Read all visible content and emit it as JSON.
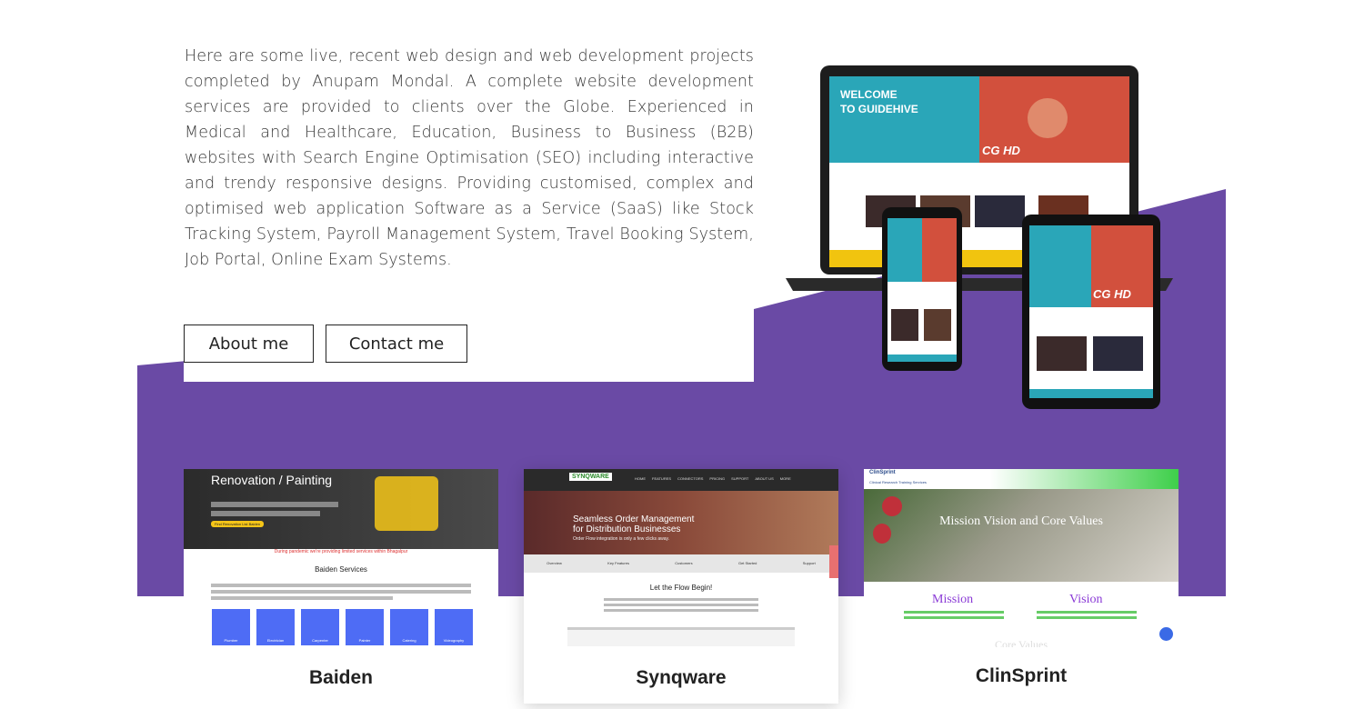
{
  "intro": {
    "text": "Here are some live, recent web design and web development projects completed by Anupam Mondal. A complete website development services are provided to clients over the Globe. Experienced in Medical and Healthcare, Education, Business to Business (B2B) websites with Search Engine Optimisation (SEO) including interactive and trendy responsive designs. Providing customised, complex and optimised web application Software as a Service (SaaS) like Stock Tracking System, Payroll Management System, Travel Booking System, Job Portal, Online Exam Systems."
  },
  "buttons": {
    "about": "About me",
    "contact": "Contact me"
  },
  "devices": {
    "welcome_line1": "WELCOME",
    "welcome_line2": "TO GUIDEHIVE",
    "hd_badge": "CG HD"
  },
  "projects": [
    {
      "title": "Baiden",
      "hero": "Renovation / Painting",
      "cta": "Find Renovation List Baiden",
      "notice": "During pandemic we're providing limited services within Bhagalpur",
      "heading": "Baiden Services",
      "services": [
        "Plumber",
        "Electrician",
        "Carpenter",
        "Painter",
        "Catering",
        "Videography"
      ]
    },
    {
      "title": "Synqware",
      "logo": "SYNQWARE",
      "nav": [
        "HOME",
        "FEATURES",
        "CONNECTORS",
        "PRICING",
        "SUPPORT",
        "ABOUT US",
        "MORE"
      ],
      "hero_line1": "Seamless Order Management",
      "hero_line2": "for Distribution Businesses",
      "hero_sub": "Order Flow integration is only a few clicks away.",
      "tabs": [
        "Overview",
        "Key Features",
        "Customers",
        "Get Started",
        "Support"
      ],
      "heading": "Let the Flow Begin!"
    },
    {
      "title": "ClinSprint",
      "logo": "ClinSprint",
      "tagline": "Clinical Research Training Services",
      "hero": "Mission Vision and Core Values",
      "col1": "Mission",
      "col2": "Vision",
      "footer": "Core Values"
    }
  ],
  "colors": {
    "purple": "#6a4aa5",
    "accent_blue": "#4e6cf5",
    "green": "#3ecf4a"
  }
}
